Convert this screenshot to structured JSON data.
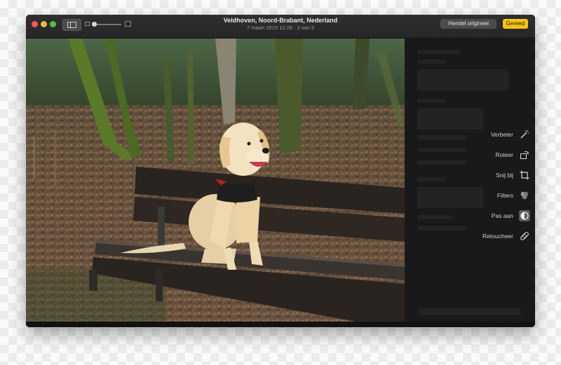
{
  "window": {
    "title": "Veldhoven, Noord-Brabant, Nederland",
    "date": "7 maart 2015 12:28",
    "position": "2 van 5",
    "restore_label": "Herstel origineel",
    "done_label": "Gereed"
  },
  "tools": [
    {
      "label": "Verbeter",
      "icon": "magic-wand-icon"
    },
    {
      "label": "Roteer",
      "icon": "rotate-icon"
    },
    {
      "label": "Snij bij",
      "icon": "crop-icon"
    },
    {
      "label": "Filters",
      "icon": "filters-icon"
    },
    {
      "label": "Pas aan",
      "icon": "adjust-icon",
      "active": true
    },
    {
      "label": "Retoucheer",
      "icon": "bandage-icon"
    }
  ],
  "colors": {
    "accent": "#f7c414",
    "window_bg": "#1c1c1e",
    "panel_bg": "#19191b"
  }
}
